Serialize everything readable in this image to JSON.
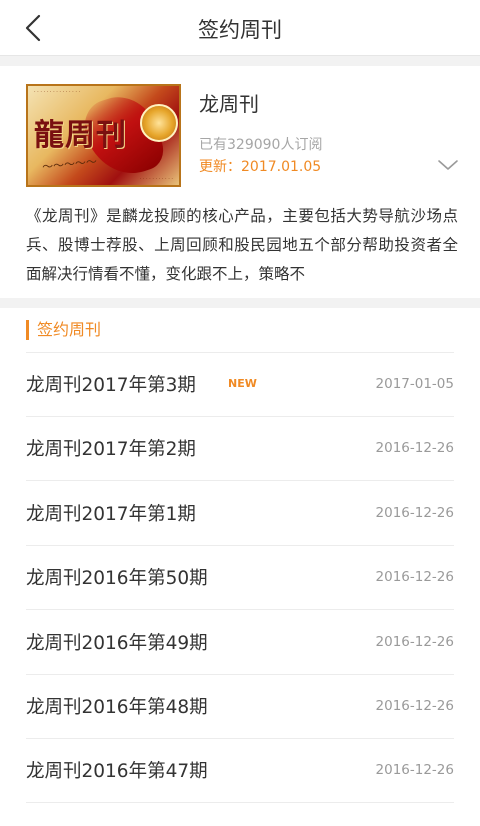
{
  "header": {
    "title": "签约周刊",
    "back_icon": "chevron-left-icon"
  },
  "magazine": {
    "name": "龙周刊",
    "cover_text": "龍周刊",
    "subscribers": "已有329090人订阅",
    "updated_label": "更新：",
    "updated_date": "2017.01.05",
    "expand_icon": "chevron-down-icon",
    "description": "《龙周刊》是麟龙投顾的核心产品，主要包括大势导航沙场点兵、股博士荐股、上周回顾和股民园地五个部分帮助投资者全面解决行情看不懂，变化跟不上，策略不"
  },
  "section": {
    "title": "签约周刊"
  },
  "issues": [
    {
      "title": "龙周刊2017年第3期",
      "badge": "NEW",
      "date": "2017-01-05"
    },
    {
      "title": "龙周刊2017年第2期",
      "badge": "",
      "date": "2016-12-26"
    },
    {
      "title": "龙周刊2017年第1期",
      "badge": "",
      "date": "2016-12-26"
    },
    {
      "title": "龙周刊2016年第50期",
      "badge": "",
      "date": "2016-12-26"
    },
    {
      "title": "龙周刊2016年第49期",
      "badge": "",
      "date": "2016-12-26"
    },
    {
      "title": "龙周刊2016年第48期",
      "badge": "",
      "date": "2016-12-26"
    },
    {
      "title": "龙周刊2016年第47期",
      "badge": "",
      "date": "2016-12-26"
    }
  ],
  "colors": {
    "accent": "#f08a24",
    "muted": "#a6a6a6",
    "divider": "#ececec"
  }
}
